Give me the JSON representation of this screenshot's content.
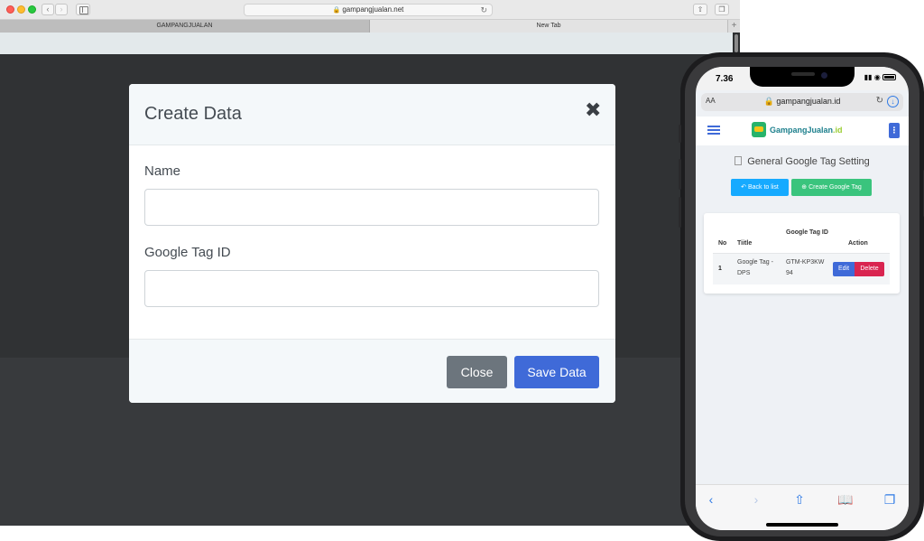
{
  "browser": {
    "url": "gampangjualan.net",
    "tabs": [
      {
        "label": "GAMPANGJUALAN"
      },
      {
        "label": "New Tab"
      }
    ]
  },
  "modal": {
    "title": "Create Data",
    "fields": [
      {
        "label": "Name",
        "value": "",
        "placeholder": ""
      },
      {
        "label": "Google Tag ID",
        "value": "",
        "placeholder": ""
      }
    ],
    "close_label": "Close",
    "save_label": "Save Data"
  },
  "phone": {
    "time": "7.36",
    "url": "gampangjualan.id",
    "url_aa": "AA",
    "logo_text": "GampangJualan",
    "logo_tld": ".id",
    "page_title": "General Google Tag Setting",
    "back_label": "Back to list",
    "create_label": "Create Google Tag",
    "table": {
      "headers": [
        "No",
        "Tiitle",
        "Google Tag ID",
        "Action"
      ],
      "rows": [
        {
          "no": "1",
          "title": "Google Tag - DPS",
          "tag_id": "GTM-KP3KW94"
        }
      ],
      "edit_label": "Edit",
      "delete_label": "Delete"
    }
  },
  "colors": {
    "primary": "#3f6ad8",
    "secondary": "#6c757d",
    "info": "#16aaff",
    "success": "#3ac47d",
    "danger": "#d92550"
  }
}
